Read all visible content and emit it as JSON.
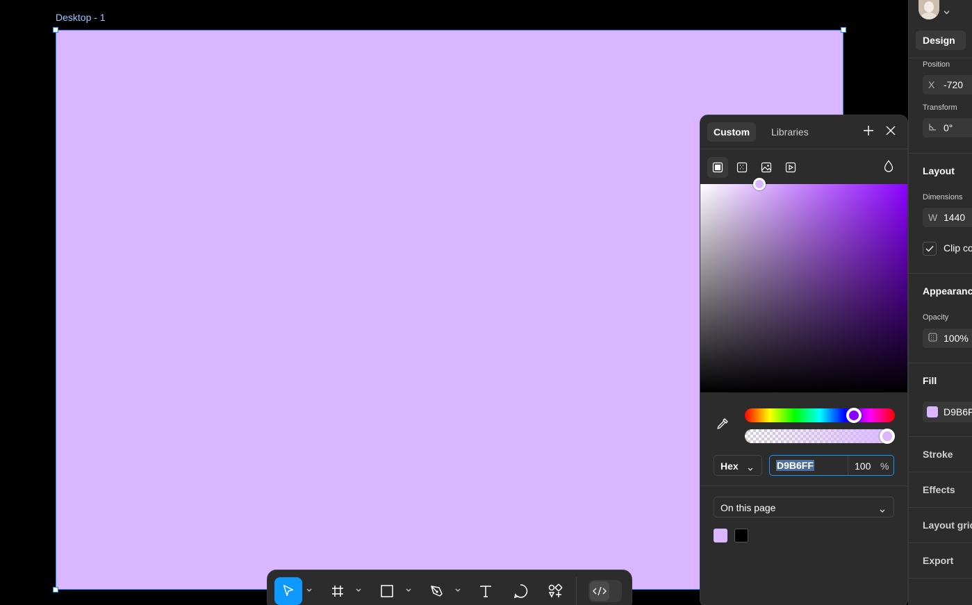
{
  "canvas": {
    "frame_label": "Desktop - 1",
    "frame_fill": "#D9B6FF",
    "selection_color": "#1c8fff"
  },
  "toolbar": {
    "tools": [
      {
        "name": "move-tool",
        "icon": "cursor-icon",
        "active": true,
        "has_menu": true
      },
      {
        "name": "frame-tool",
        "icon": "frame-hash-icon",
        "active": false,
        "has_menu": true
      },
      {
        "name": "shape-tool",
        "icon": "rectangle-icon",
        "active": false,
        "has_menu": true
      },
      {
        "name": "pen-tool",
        "icon": "pen-icon",
        "active": false,
        "has_menu": true
      },
      {
        "name": "text-tool",
        "icon": "text-icon",
        "active": false,
        "has_menu": false
      },
      {
        "name": "comment-tool",
        "icon": "comment-icon",
        "active": false,
        "has_menu": false
      },
      {
        "name": "resources-tool",
        "icon": "components-icon",
        "active": false,
        "has_menu": false
      }
    ],
    "dev_mode_icon": "code-icon",
    "accent": "#0d99ff"
  },
  "color_picker": {
    "tabs": {
      "custom": "Custom",
      "libraries": "Libraries"
    },
    "fill_types": [
      "solid-fill-icon",
      "gradient-fill-icon",
      "image-fill-icon",
      "video-fill-icon"
    ],
    "blend_icon": "blend-drop-icon",
    "color_mode": "Hex",
    "hex_value": "D9B6FF",
    "opacity": "100",
    "percent": "%",
    "hue_color": "#8a00ff",
    "swatch_source": "On this page",
    "swatches": [
      "#D9B6FF",
      "#000000"
    ]
  },
  "design_panel": {
    "tab": "Design",
    "position": {
      "label": "Position",
      "x_prefix": "X",
      "x_value": "-720"
    },
    "transform": {
      "label": "Transform",
      "rotation_value": "0°"
    },
    "layout": {
      "title": "Layout",
      "dimensions_label": "Dimensions",
      "w_prefix": "W",
      "w_value": "1440",
      "clip_label": "Clip co",
      "clip_checked": true
    },
    "appearance": {
      "title": "Appearanc",
      "opacity_label": "Opacity",
      "opacity_value": "100%"
    },
    "fill": {
      "title": "Fill",
      "value": "D9B6F",
      "color": "#D9B6FF"
    },
    "stroke": "Stroke",
    "effects": "Effects",
    "layout_grid": "Layout grid",
    "export": "Export"
  }
}
